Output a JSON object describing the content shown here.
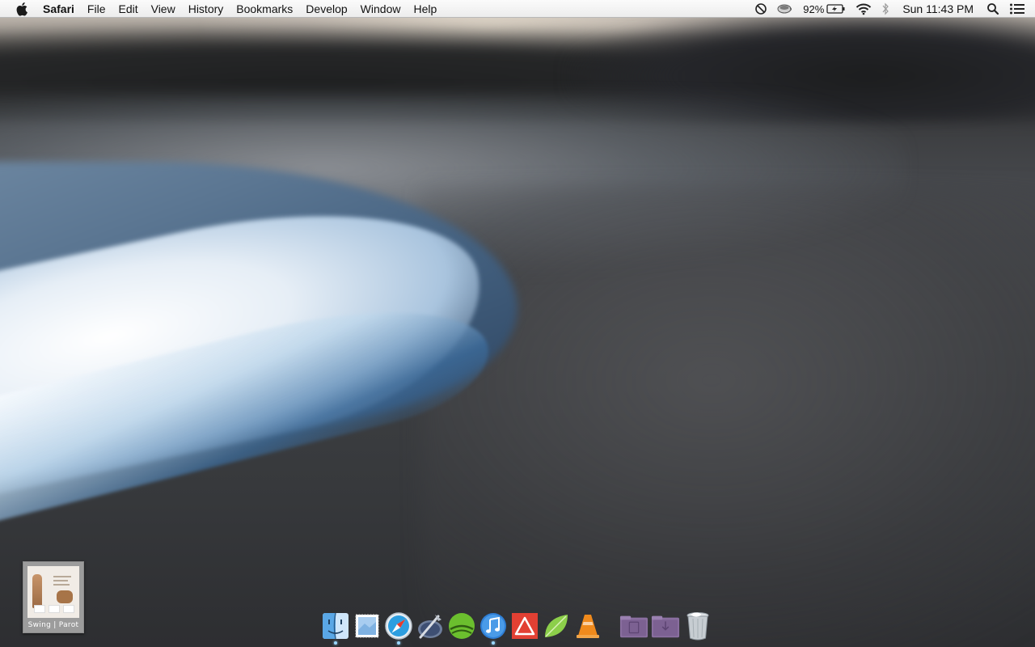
{
  "menubar": {
    "apple_icon": "apple-icon",
    "app_name": "Safari",
    "menus": [
      "File",
      "Edit",
      "View",
      "History",
      "Bookmarks",
      "Develop",
      "Window",
      "Help"
    ],
    "status": {
      "dnd_icon": "do-not-disturb-icon",
      "coffee_icon": "caffeine-cup-icon",
      "battery_percent": "92%",
      "battery_icon": "battery-charging-icon",
      "wifi_icon": "wifi-icon",
      "bluetooth_icon": "bluetooth-icon",
      "clock": "Sun 11:43 PM",
      "spotlight_icon": "spotlight-search-icon",
      "notification_icon": "notification-center-icon"
    }
  },
  "desktop": {
    "file_label": "Swing | Parot"
  },
  "dock": {
    "apps": [
      {
        "name": "Finder",
        "icon": "finder-icon",
        "running": true
      },
      {
        "name": "Mail",
        "icon": "mail-stamp-icon",
        "running": false
      },
      {
        "name": "Safari",
        "icon": "safari-compass-icon",
        "running": true
      },
      {
        "name": "Xcode",
        "icon": "xcode-icon",
        "running": false
      },
      {
        "name": "Spotify",
        "icon": "spotify-icon",
        "running": false
      },
      {
        "name": "iTunes",
        "icon": "itunes-note-icon",
        "running": true
      },
      {
        "name": "Delta",
        "icon": "red-triangle-app-icon",
        "running": false
      },
      {
        "name": "Leaf",
        "icon": "green-leaf-icon",
        "running": false
      },
      {
        "name": "VLC",
        "icon": "vlc-cone-icon",
        "running": false
      }
    ],
    "stacks": [
      {
        "name": "Documents",
        "icon": "purple-folder-icon"
      },
      {
        "name": "Downloads",
        "icon": "purple-downloads-folder-icon"
      }
    ],
    "trash_icon": "trash-icon",
    "colors": {
      "indicator": "#9ad7ff",
      "finder": "#5aa7e6",
      "safari": "#2d9ee0",
      "spotify": "#6bbf2e",
      "itunes": "#2f7fd6",
      "delta": "#e24033",
      "leaf": "#8ccf4a",
      "vlc": "#f08a1c",
      "stack": "#8a6fa0"
    }
  }
}
